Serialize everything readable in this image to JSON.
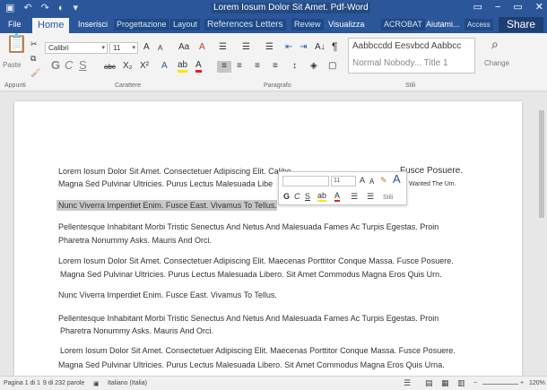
{
  "titlebar": {
    "doc_title": "Lorem Iosum Dolor Sit Amet. Pdf-Word",
    "qat": [
      "▣",
      "↶",
      "↷",
      "◐",
      "▾"
    ],
    "controls": [
      "▭",
      "−",
      "▭",
      "✕"
    ]
  },
  "tabs": {
    "file": "File",
    "home": "Home",
    "insert": "Inserisci",
    "design": "Progettazione",
    "layout": "Layout",
    "references": "References Letters",
    "review": "Review",
    "view": "Visualizza",
    "acrobat": "ACROBAT",
    "help": "Aiutami...",
    "access": "Access",
    "share": "Share"
  },
  "ribbon": {
    "paste_label": "Paste",
    "clipboard_label": "Appunti",
    "font_name": "Calibri",
    "font_size": "11",
    "font_group_label": "Carattere",
    "paragraph_group_label": "Paragrafo",
    "styles_group_label": "Stili",
    "style_sample_1": "Aabbccdd Eesvbcd Aabbcc",
    "style_sample_2": "Normal Nobody... Title 1",
    "change_label": "Change",
    "bold": "G",
    "italic": "C",
    "underline": "S",
    "strike": "abc",
    "sub": "X₂",
    "sup": "X²",
    "grow": "A",
    "shrink": "A",
    "case": "Aa",
    "clear": "A",
    "text_effects": "A",
    "highlight": "ab",
    "font_color": "A",
    "bullets": "☰",
    "numbering": "☰",
    "multilevel": "☰",
    "indent_less": "⇤",
    "indent_more": "⇥",
    "sort": "A↓",
    "pilcrow": "¶"
  },
  "document": {
    "lines": [
      "Lorem Iosum Dolor Sit Amet. Consectetuer Adipiscing Elit. Calibe",
      "Magna Sed Pulvinar Ultricies. Purus Lectus Malesuada Libe",
      "Nunc Viverra Imperdiet Enim. Fusce East. Vivamus To Tellus.",
      "Pellentesque Inhabitant Morbi Tristic Senectus And Netus And Malesuada Fames Ac Turpis Egestas. Proin",
      "Pharetra Nonummy Asks. Mauris And Orci.",
      "Lorem Iosum Dolor Sit Amet. Consectetuer Adipiscing Elit. Maecenas Porttitor Conque Massa. Fusce Posuere.",
      "Magna Sed Pulvinar Ultricies. Purus Lectus Malesuada Libero. Sit Amet Commodus Magna Eros Quis Urn.",
      "Nunc Viverra Imperdiet Enim. Fusce East. Vivamus To Tellus.",
      "Pellentesque Inhabitant Morbi Tristic Senectus And Netus And Malesuada Fames Ac Turpis Egestas. Proin",
      "Pharetra Nonummy Asks. Mauris And Orci.",
      "Lorem Iosum Dolor Sit Amet. Consectetuer Adipiscing Elit. Maecenas Porttitor Conque Massa. Fusce Posuere.",
      "Magna Sed Pulvinar Ultricies. Purus Lectus Malesuada Libero. Sit Amet Commodus Magna Eros Quis Urna."
    ],
    "line1_tail": "Fusce Posuere.",
    "line2_tail": "Wanted The Um."
  },
  "mini_toolbar": {
    "font": "",
    "size": "11",
    "bold": "G",
    "italic": "C",
    "underline": "S",
    "styles": "Stili"
  },
  "status": {
    "page": "Pagina 1 di 1",
    "words": "9 di 232 parole",
    "language": "Italiano (Italia)",
    "zoom": "120%"
  }
}
